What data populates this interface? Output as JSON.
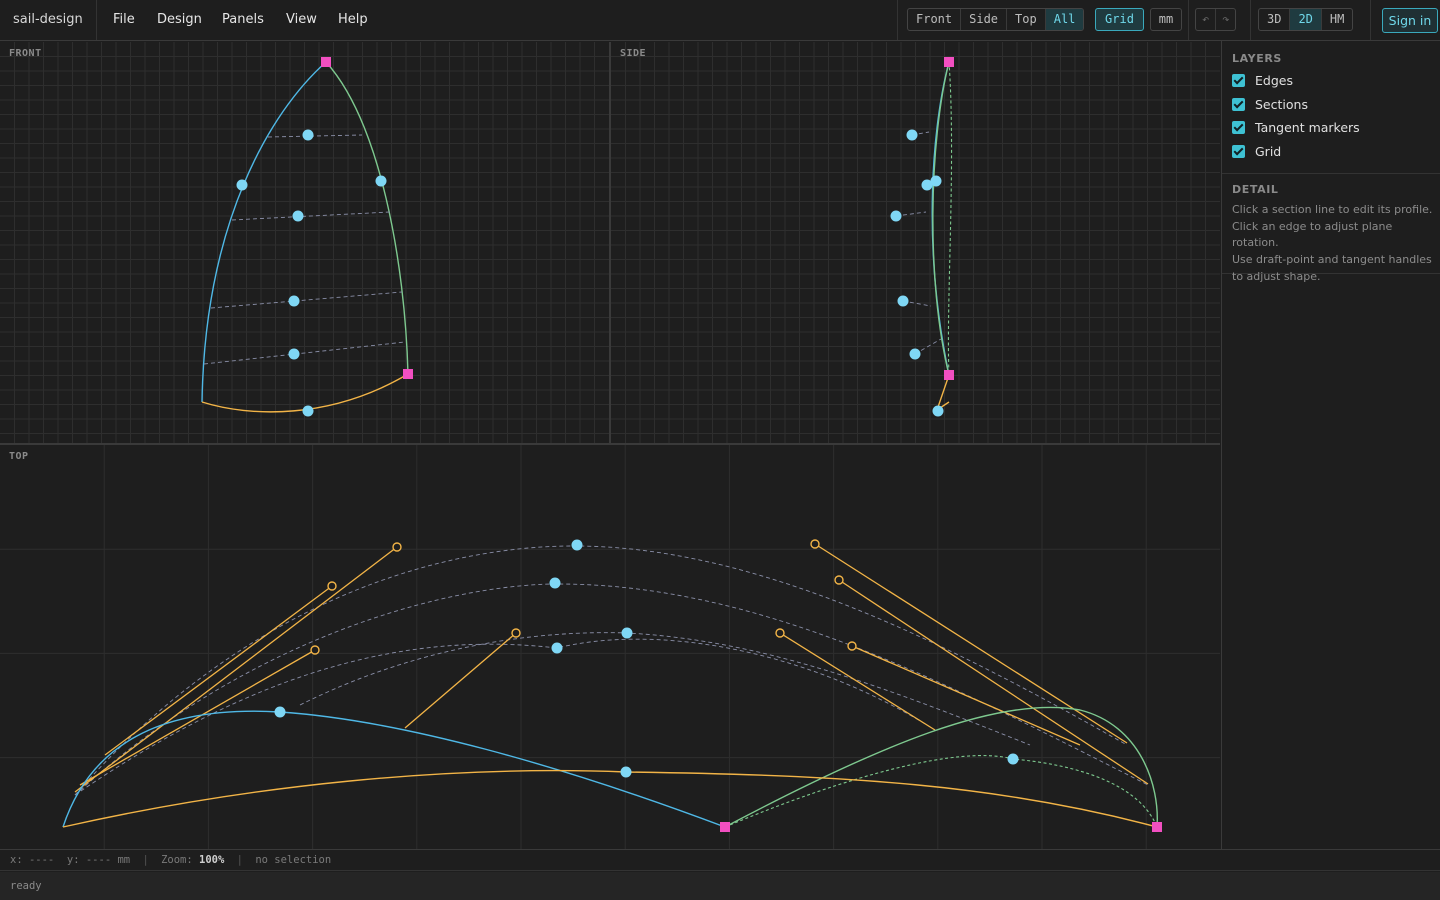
{
  "app": {
    "title": "sail-design"
  },
  "menu": [
    "File",
    "Design",
    "Panels",
    "View",
    "Help"
  ],
  "toolbar": {
    "views": [
      "Front",
      "Side",
      "Top",
      "All"
    ],
    "active_view": "All",
    "grid_label": "Grid",
    "unit_label": "mm",
    "undo_icon": "undo-icon",
    "redo_icon": "redo-icon",
    "modes": [
      "3D",
      "2D",
      "HM"
    ],
    "active_mode": "2D",
    "signin_label": "Sign in"
  },
  "panes": {
    "front": "FRONT",
    "side": "SIDE",
    "top": "TOP"
  },
  "colors": {
    "background": "#1e1e1e",
    "grid_line": "#2e2e2e",
    "accent": "#3ec1d3",
    "luff_edge": "#4fb8e6",
    "leech_edge": "#7ec98f",
    "foot_edge": "#f2b447",
    "handle_point": "#7fd7f5",
    "corner_point": "#f24fc1",
    "section_line": "#8a8fa8"
  },
  "sidebar": {
    "layers_title": "LAYERS",
    "layers": [
      {
        "label": "Edges",
        "checked": true
      },
      {
        "label": "Sections",
        "checked": true
      },
      {
        "label": "Tangent markers",
        "checked": true
      },
      {
        "label": "Grid",
        "checked": true
      }
    ],
    "detail_title": "DETAIL",
    "detail_lines": [
      "Click a section line to edit its profile.",
      "Click an edge to adjust plane rotation.",
      "Use draft-point and tangent handles",
      "to adjust shape."
    ]
  },
  "status": {
    "coords_label": "x: ----  y: ---- mm",
    "zoom_prefix": "Zoom:",
    "zoom_value": "100%",
    "selection": "no selection"
  },
  "footer": {
    "text": "ready"
  }
}
